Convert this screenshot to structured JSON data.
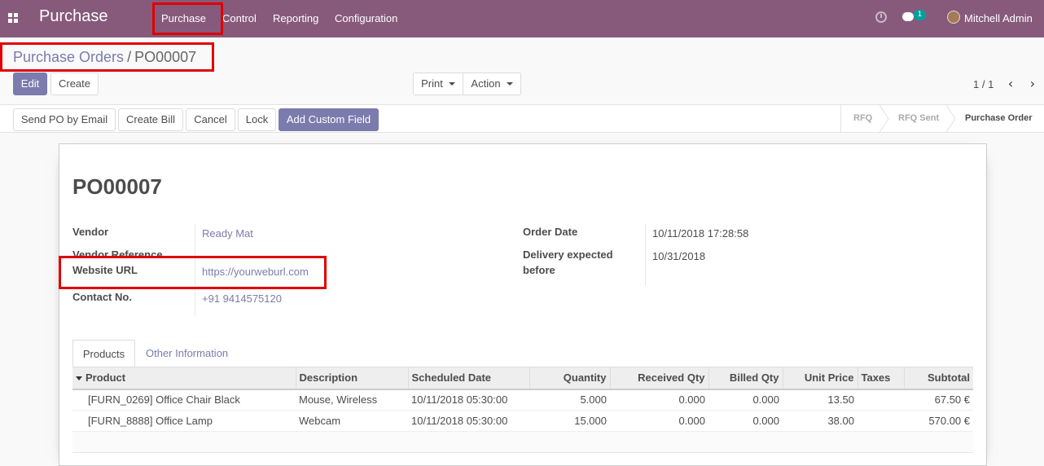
{
  "navbar": {
    "brand": "Purchase",
    "menu": [
      "Purchase",
      "Control",
      "Reporting",
      "Configuration"
    ],
    "chat_badge": "1",
    "user_name": "Mitchell Admin"
  },
  "breadcrumb": {
    "parent": "Purchase Orders",
    "separator": "/",
    "current": "PO00007"
  },
  "buttons": {
    "edit": "Edit",
    "create": "Create",
    "print": "Print",
    "action": "Action"
  },
  "pager": {
    "value": "1 / 1",
    "prev": "‹",
    "next": "›"
  },
  "statusbar_buttons": {
    "send_po": "Send PO by Email",
    "create_bill": "Create Bill",
    "cancel": "Cancel",
    "lock": "Lock",
    "add_custom_field": "Add Custom Field"
  },
  "status_steps": [
    "RFQ",
    "RFQ Sent",
    "Purchase Order"
  ],
  "status_active": "Purchase Order",
  "form": {
    "title": "PO00007",
    "vendor_label": "Vendor",
    "vendor_value": "Ready Mat",
    "vendor_ref_label": "Vendor Reference",
    "website_label": "Website URL",
    "website_value": "https://yourweburl.com",
    "contact_label": "Contact No.",
    "contact_value": "+91 9414575120",
    "order_date_label": "Order Date",
    "order_date_value": "10/11/2018 17:28:58",
    "delivery_label_1": "Delivery expected",
    "delivery_label_2": "before",
    "delivery_value": "10/31/2018"
  },
  "tabs": [
    "Products",
    "Other Information"
  ],
  "table": {
    "columns": [
      "Product",
      "Description",
      "Scheduled Date",
      "Quantity",
      "Received Qty",
      "Billed Qty",
      "Unit Price",
      "Taxes",
      "Subtotal"
    ],
    "rows": [
      [
        "[FURN_0269] Office Chair Black",
        "Mouse, Wireless",
        "10/11/2018 05:30:00",
        "5.000",
        "0.000",
        "0.000",
        "13.50",
        "",
        "67.50 €"
      ],
      [
        "[FURN_8888] Office Lamp",
        "Webcam",
        "10/11/2018 05:30:00",
        "15.000",
        "0.000",
        "0.000",
        "38.00",
        "",
        "570.00 €"
      ]
    ]
  },
  "colors": {
    "navbar": "#875a7b",
    "primary": "#7c7bad",
    "highlight": "#e00000"
  }
}
